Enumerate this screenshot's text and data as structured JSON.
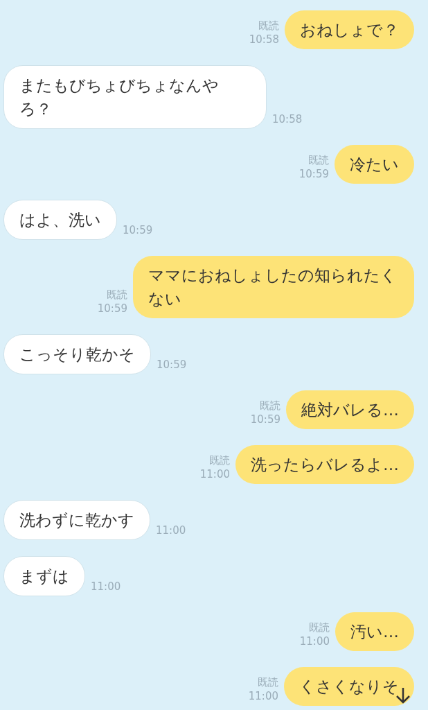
{
  "messages": [
    {
      "kind": "sent",
      "text": "おねしょで？",
      "read": "既読",
      "time": "10:58"
    },
    {
      "kind": "received",
      "text": "またもびちょびちょなんやろ？",
      "time": "10:58"
    },
    {
      "kind": "sent",
      "text": "冷たい",
      "read": "既読",
      "time": "10:59"
    },
    {
      "kind": "received",
      "text": "はよ、洗い",
      "time": "10:59"
    },
    {
      "kind": "sent",
      "text": "ママにおねしょしたの知られたくない",
      "read": "既読",
      "time": "10:59"
    },
    {
      "kind": "received",
      "text": "こっそり乾かそ",
      "time": "10:59"
    },
    {
      "kind": "sent",
      "text": "絶対バレる…",
      "read": "既読",
      "time": "10:59"
    },
    {
      "kind": "sent",
      "text": "洗ったらバレるよ…",
      "read": "既読",
      "time": "11:00"
    },
    {
      "kind": "received",
      "text": "洗わずに乾かす",
      "time": "11:00"
    },
    {
      "kind": "received",
      "text": "まずは",
      "time": "11:00"
    },
    {
      "kind": "sent",
      "text": "汚い…",
      "read": "既読",
      "time": "11:00"
    },
    {
      "kind": "sent",
      "text": "くさくなりそ",
      "read": "既読",
      "time": "11:00"
    }
  ]
}
